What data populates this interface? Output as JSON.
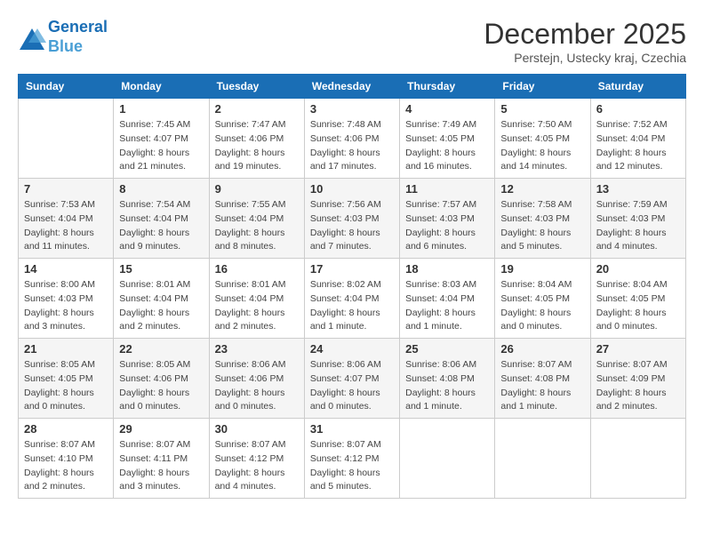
{
  "logo": {
    "line1": "General",
    "line2": "Blue"
  },
  "title": "December 2025",
  "subtitle": "Perstejn, Ustecky kraj, Czechia",
  "weekdays": [
    "Sunday",
    "Monday",
    "Tuesday",
    "Wednesday",
    "Thursday",
    "Friday",
    "Saturday"
  ],
  "weeks": [
    [
      {
        "day": null,
        "info": null
      },
      {
        "day": "1",
        "sunrise": "7:45 AM",
        "sunset": "4:07 PM",
        "daylight": "8 hours and 21 minutes."
      },
      {
        "day": "2",
        "sunrise": "7:47 AM",
        "sunset": "4:06 PM",
        "daylight": "8 hours and 19 minutes."
      },
      {
        "day": "3",
        "sunrise": "7:48 AM",
        "sunset": "4:06 PM",
        "daylight": "8 hours and 17 minutes."
      },
      {
        "day": "4",
        "sunrise": "7:49 AM",
        "sunset": "4:05 PM",
        "daylight": "8 hours and 16 minutes."
      },
      {
        "day": "5",
        "sunrise": "7:50 AM",
        "sunset": "4:05 PM",
        "daylight": "8 hours and 14 minutes."
      },
      {
        "day": "6",
        "sunrise": "7:52 AM",
        "sunset": "4:04 PM",
        "daylight": "8 hours and 12 minutes."
      }
    ],
    [
      {
        "day": "7",
        "sunrise": "7:53 AM",
        "sunset": "4:04 PM",
        "daylight": "8 hours and 11 minutes."
      },
      {
        "day": "8",
        "sunrise": "7:54 AM",
        "sunset": "4:04 PM",
        "daylight": "8 hours and 9 minutes."
      },
      {
        "day": "9",
        "sunrise": "7:55 AM",
        "sunset": "4:04 PM",
        "daylight": "8 hours and 8 minutes."
      },
      {
        "day": "10",
        "sunrise": "7:56 AM",
        "sunset": "4:03 PM",
        "daylight": "8 hours and 7 minutes."
      },
      {
        "day": "11",
        "sunrise": "7:57 AM",
        "sunset": "4:03 PM",
        "daylight": "8 hours and 6 minutes."
      },
      {
        "day": "12",
        "sunrise": "7:58 AM",
        "sunset": "4:03 PM",
        "daylight": "8 hours and 5 minutes."
      },
      {
        "day": "13",
        "sunrise": "7:59 AM",
        "sunset": "4:03 PM",
        "daylight": "8 hours and 4 minutes."
      }
    ],
    [
      {
        "day": "14",
        "sunrise": "8:00 AM",
        "sunset": "4:03 PM",
        "daylight": "8 hours and 3 minutes."
      },
      {
        "day": "15",
        "sunrise": "8:01 AM",
        "sunset": "4:04 PM",
        "daylight": "8 hours and 2 minutes."
      },
      {
        "day": "16",
        "sunrise": "8:01 AM",
        "sunset": "4:04 PM",
        "daylight": "8 hours and 2 minutes."
      },
      {
        "day": "17",
        "sunrise": "8:02 AM",
        "sunset": "4:04 PM",
        "daylight": "8 hours and 1 minute."
      },
      {
        "day": "18",
        "sunrise": "8:03 AM",
        "sunset": "4:04 PM",
        "daylight": "8 hours and 1 minute."
      },
      {
        "day": "19",
        "sunrise": "8:04 AM",
        "sunset": "4:05 PM",
        "daylight": "8 hours and 0 minutes."
      },
      {
        "day": "20",
        "sunrise": "8:04 AM",
        "sunset": "4:05 PM",
        "daylight": "8 hours and 0 minutes."
      }
    ],
    [
      {
        "day": "21",
        "sunrise": "8:05 AM",
        "sunset": "4:05 PM",
        "daylight": "8 hours and 0 minutes."
      },
      {
        "day": "22",
        "sunrise": "8:05 AM",
        "sunset": "4:06 PM",
        "daylight": "8 hours and 0 minutes."
      },
      {
        "day": "23",
        "sunrise": "8:06 AM",
        "sunset": "4:06 PM",
        "daylight": "8 hours and 0 minutes."
      },
      {
        "day": "24",
        "sunrise": "8:06 AM",
        "sunset": "4:07 PM",
        "daylight": "8 hours and 0 minutes."
      },
      {
        "day": "25",
        "sunrise": "8:06 AM",
        "sunset": "4:08 PM",
        "daylight": "8 hours and 1 minute."
      },
      {
        "day": "26",
        "sunrise": "8:07 AM",
        "sunset": "4:08 PM",
        "daylight": "8 hours and 1 minute."
      },
      {
        "day": "27",
        "sunrise": "8:07 AM",
        "sunset": "4:09 PM",
        "daylight": "8 hours and 2 minutes."
      }
    ],
    [
      {
        "day": "28",
        "sunrise": "8:07 AM",
        "sunset": "4:10 PM",
        "daylight": "8 hours and 2 minutes."
      },
      {
        "day": "29",
        "sunrise": "8:07 AM",
        "sunset": "4:11 PM",
        "daylight": "8 hours and 3 minutes."
      },
      {
        "day": "30",
        "sunrise": "8:07 AM",
        "sunset": "4:12 PM",
        "daylight": "8 hours and 4 minutes."
      },
      {
        "day": "31",
        "sunrise": "8:07 AM",
        "sunset": "4:12 PM",
        "daylight": "8 hours and 5 minutes."
      },
      {
        "day": null,
        "info": null
      },
      {
        "day": null,
        "info": null
      },
      {
        "day": null,
        "info": null
      }
    ]
  ],
  "colors": {
    "header_bg": "#1a6eb5",
    "header_text": "#ffffff",
    "accent": "#1a6eb5"
  }
}
